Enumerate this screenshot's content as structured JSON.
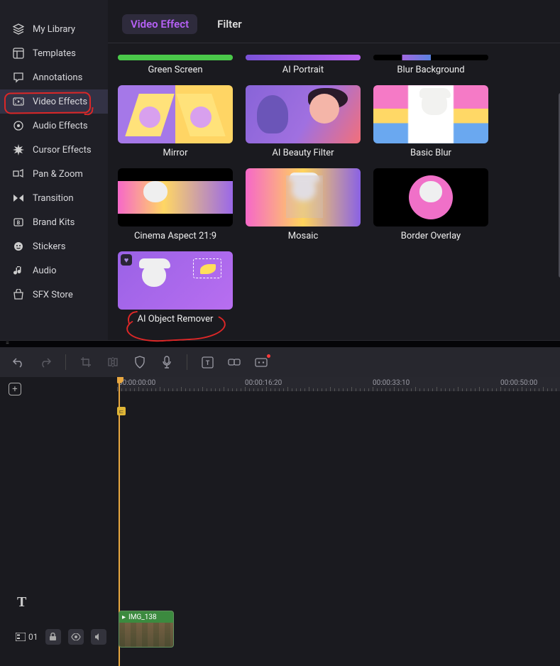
{
  "sidebar": {
    "items": [
      {
        "icon": "layers-icon",
        "label": "My Library"
      },
      {
        "icon": "template-icon",
        "label": "Templates"
      },
      {
        "icon": "annotation-icon",
        "label": "Annotations"
      },
      {
        "icon": "video-fx-icon",
        "label": "Video Effects"
      },
      {
        "icon": "audio-fx-icon",
        "label": "Audio Effects"
      },
      {
        "icon": "cursor-fx-icon",
        "label": "Cursor Effects"
      },
      {
        "icon": "pan-zoom-icon",
        "label": "Pan & Zoom"
      },
      {
        "icon": "transition-icon",
        "label": "Transition"
      },
      {
        "icon": "brand-icon",
        "label": "Brand Kits"
      },
      {
        "icon": "sticker-icon",
        "label": "Stickers"
      },
      {
        "icon": "audio-icon",
        "label": "Audio"
      },
      {
        "icon": "store-icon",
        "label": "SFX Store"
      }
    ],
    "active_index": 3
  },
  "tabs": {
    "items": [
      "Video Effect",
      "Filter"
    ],
    "active_index": 0
  },
  "effects": [
    {
      "label": "Green Screen",
      "thumb": "green",
      "partial": true
    },
    {
      "label": "AI Portrait",
      "thumb": "aip",
      "partial": true
    },
    {
      "label": "Blur Background",
      "thumb": "blurbg",
      "partial": true
    },
    {
      "label": "Mirror",
      "thumb": "mirror"
    },
    {
      "label": "AI Beauty Filter",
      "thumb": "beauty"
    },
    {
      "label": "Basic Blur",
      "thumb": "basic"
    },
    {
      "label": "Cinema Aspect 21:9",
      "thumb": "cinema"
    },
    {
      "label": "Mosaic",
      "thumb": "mosaic"
    },
    {
      "label": "Border Overlay",
      "thumb": "border"
    },
    {
      "label": "AI Object Remover",
      "thumb": "obj"
    }
  ],
  "timeline": {
    "ruler": [
      "00:00:00:00",
      "00:00:16:20",
      "00:00:33:10",
      "00:00:50:00"
    ],
    "track_count": "01",
    "clip_label": "IMG_138",
    "clip_icon": "video"
  },
  "toolbar": {
    "buttons": [
      {
        "name": "undo-icon",
        "dim": false
      },
      {
        "name": "redo-icon",
        "dim": true
      },
      {
        "sep": true
      },
      {
        "name": "crop-icon",
        "dim": true
      },
      {
        "name": "split-icon",
        "dim": true
      },
      {
        "name": "shield-icon"
      },
      {
        "name": "mic-icon"
      },
      {
        "sep": true
      },
      {
        "name": "text-box-icon"
      },
      {
        "name": "link-icon"
      },
      {
        "name": "fx-icon",
        "dot": true
      }
    ]
  }
}
